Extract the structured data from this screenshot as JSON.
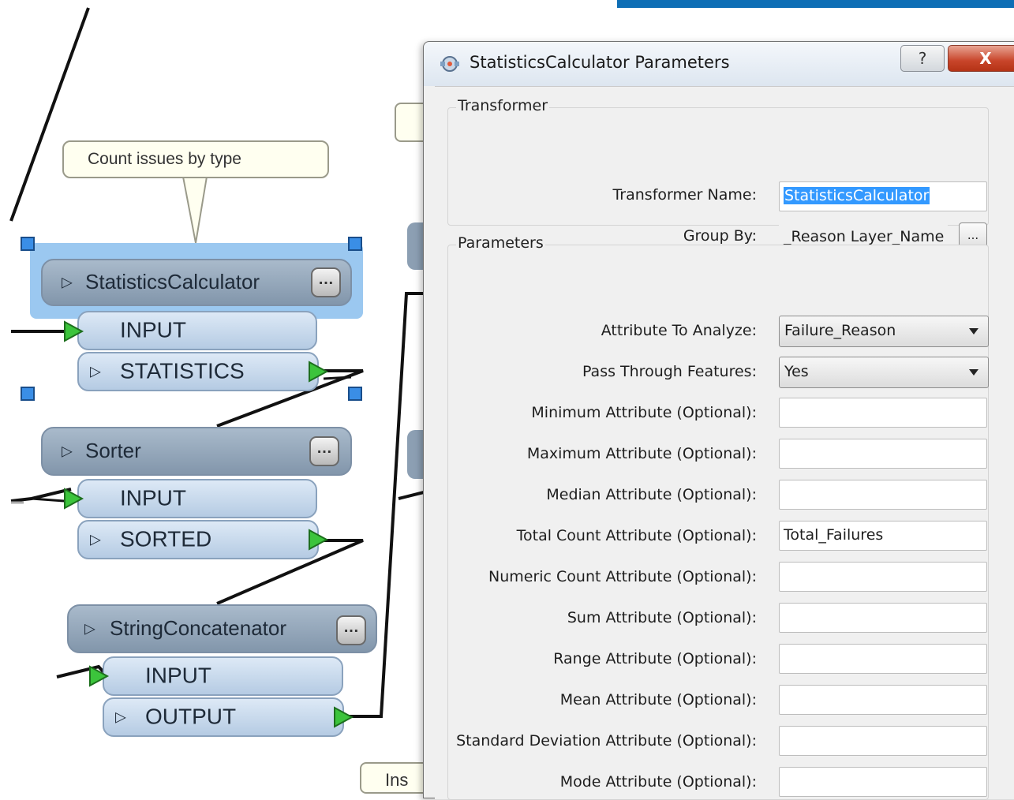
{
  "canvas": {
    "annotation": "Count issues by type",
    "bottom_annotation_fragment": "Ins",
    "transformers": [
      {
        "name": "StatisticsCalculator",
        "ellipsis": "…",
        "ports": [
          {
            "label": "INPUT",
            "type": "input"
          },
          {
            "label": "STATISTICS",
            "type": "output"
          }
        ]
      },
      {
        "name": "Sorter",
        "ellipsis": "…",
        "ports": [
          {
            "label": "INPUT",
            "type": "input"
          },
          {
            "label": "SORTED",
            "type": "output"
          }
        ]
      },
      {
        "name": "StringConcatenator",
        "ellipsis": "…",
        "ports": [
          {
            "label": "INPUT",
            "type": "input"
          },
          {
            "label": "OUTPUT",
            "type": "output"
          }
        ]
      }
    ]
  },
  "dialog": {
    "title": "StatisticsCalculator Parameters",
    "help_label": "?",
    "close_label": "X",
    "transformer_section": {
      "title": "Transformer",
      "name_label": "Transformer Name:",
      "name_value": "StatisticsCalculator",
      "group_by_label": "Group By:",
      "group_by_value": "_Reason Layer_Name",
      "group_by_button": "..."
    },
    "parameters_section": {
      "title": "Parameters",
      "attribute_to_analyze_label": "Attribute To Analyze:",
      "attribute_to_analyze_value": "Failure_Reason",
      "pass_through_label": "Pass Through Features:",
      "pass_through_value": "Yes",
      "optional_fields": [
        {
          "label": "Minimum Attribute (Optional):",
          "value": ""
        },
        {
          "label": "Maximum Attribute (Optional):",
          "value": ""
        },
        {
          "label": "Median Attribute (Optional):",
          "value": ""
        },
        {
          "label": "Total Count Attribute (Optional):",
          "value": "Total_Failures"
        },
        {
          "label": "Numeric Count Attribute (Optional):",
          "value": ""
        },
        {
          "label": "Sum Attribute (Optional):",
          "value": ""
        },
        {
          "label": "Range Attribute (Optional):",
          "value": ""
        },
        {
          "label": "Mean Attribute (Optional):",
          "value": ""
        },
        {
          "label": "Standard Deviation Attribute (Optional):",
          "value": ""
        },
        {
          "label": "Mode Attribute (Optional):",
          "value": ""
        }
      ]
    }
  },
  "colors": {
    "accent": "#0e6eb5",
    "transformer_header": "#8f a3b8",
    "port_arrow": "#3cc43c",
    "selection": "#9bc8f0",
    "close_button": "#c8452a"
  }
}
